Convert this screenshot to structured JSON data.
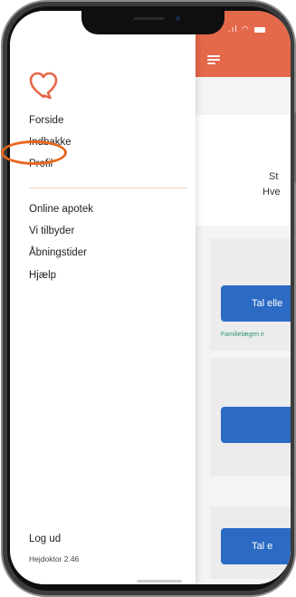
{
  "drawer": {
    "nav_top": {
      "forside": "Forside",
      "indbakke": "Indbakke",
      "profil": "Profil"
    },
    "nav_bottom": {
      "online_apotek": "Online apotek",
      "vi_tilbyder": "Vi tilbyder",
      "aabningstider": "Åbningstider",
      "hjaelp": "Hjælp"
    },
    "logout": "Log ud",
    "version": "Hejdoktor 2.46"
  },
  "background_app": {
    "intro_line_1": "St",
    "intro_line_2": "Hve",
    "card_1_button": "Tal elle",
    "card_1_caption": "Familielægen e",
    "card_2_button": "",
    "card_3_button": "Tal e"
  },
  "colors": {
    "brand": "#e4684a",
    "button_blue": "#2c6bc4",
    "caption_green": "#2f9a6f",
    "highlight_orange": "#e8671f"
  },
  "icons": {
    "logo": "heart-speech-bubble-icon",
    "menu": "hamburger-menu-icon",
    "wifi": "wifi-icon",
    "battery": "battery-icon"
  },
  "annotation": {
    "highlighted_item": "Profil"
  }
}
